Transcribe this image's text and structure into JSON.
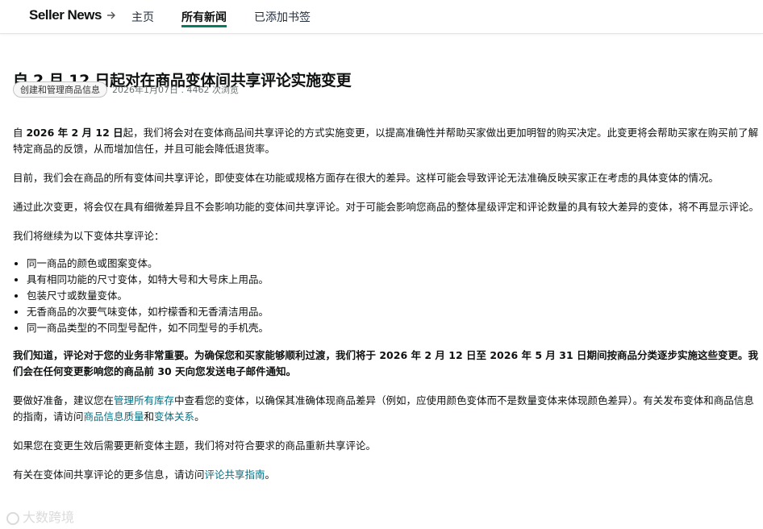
{
  "header": {
    "brand": "Seller News",
    "nav": {
      "home": "主页",
      "all_news": "所有新闻",
      "bookmarks": "已添加书签"
    }
  },
  "article": {
    "title": "自 2 月 12 日起对在商品变体间共享评论实施变更",
    "tag": "创建和管理商品信息",
    "meta": "2026年1月07日 . 4462 次浏览",
    "p1_lead": "自 ",
    "p1_bold": "2026 年 2 月 12 日",
    "p1_rest": "起，我们将会对在变体商品间共享评论的方式实施变更，以提高准确性并帮助买家做出更加明智的购买决定。此变更将会帮助买家在购买前了解特定商品的反馈，从而增加信任，并且可能会降低退货率。",
    "p2": "目前，我们会在商品的所有变体间共享评论，即使变体在功能或规格方面存在很大的差异。这样可能会导致评论无法准确反映买家正在考虑的具体变体的情况。",
    "p3": "通过此次变更，将会仅在具有细微差异且不会影响功能的变体间共享评论。对于可能会影响您商品的整体星级评定和评论数量的具有较大差异的变体，将不再显示评论。",
    "p4": "我们将继续为以下变体共享评论：",
    "bullets": [
      "同一商品的颜色或图案变体。",
      "具有相同功能的尺寸变体，如特大号和大号床上用品。",
      "包装尺寸或数量变体。",
      "无香商品的次要气味变体，如柠檬香和无香清洁用品。",
      "同一商品类型的不同型号配件，如不同型号的手机壳。"
    ],
    "p5_bold": "我们知道，评论对于您的业务非常重要。为确保您和买家能够顺利过渡，我们将于 2026 年 2 月 12 日至 2026 年 5 月 31 日期间按商品分类逐步实施这些变更。我们会在任何变更影响您的商品前 30 天向您发送电子邮件通知。",
    "p6_a": "要做好准备，建议您在",
    "p6_link1": "管理所有库存",
    "p6_b": "中查看您的变体，以确保其准确体现商品差异（例如，应使用颜色变体而不是数量变体来体现颜色差异）。有关发布变体和商品信息的指南，请访问",
    "p6_link2": "商品信息质量",
    "p6_c": "和",
    "p6_link3": "变体关系",
    "p6_d": "。",
    "p7": "如果您在变更生效后需要更新变体主题，我们将对符合要求的商品重新共享评论。",
    "p8_a": "有关在变体间共享评论的更多信息，请访问",
    "p8_link": "评论共享指南",
    "p8_b": "。"
  },
  "watermark": "大数跨境",
  "colors": {
    "accent_underline": "#067d62",
    "link": "#007185",
    "text": "#0f1111"
  }
}
